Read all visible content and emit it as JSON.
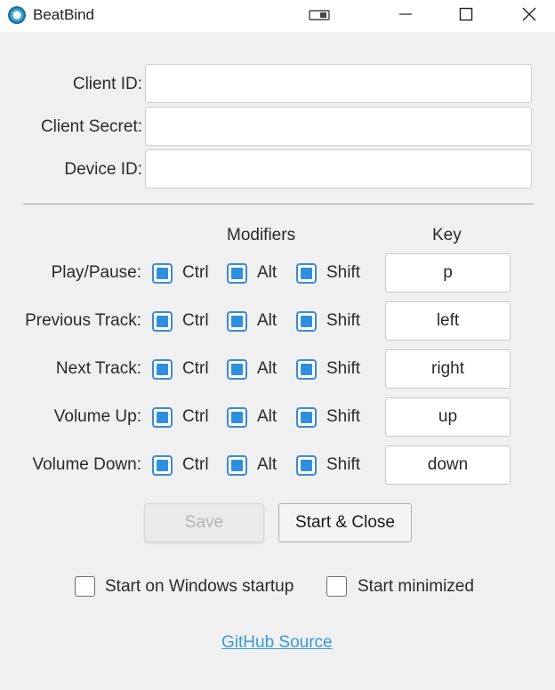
{
  "window": {
    "title": "BeatBind",
    "icons": [
      "app-icon",
      "snap-layout-icon",
      "minimize-icon",
      "maximize-icon",
      "close-icon"
    ]
  },
  "credentials": {
    "client_id_label": "Client ID:",
    "client_id_value": "",
    "client_secret_label": "Client Secret:",
    "client_secret_value": "",
    "device_id_label": "Device ID:",
    "device_id_value": ""
  },
  "hotkeys": {
    "modifiers_header": "Modifiers",
    "key_header": "Key",
    "ctrl_label": "Ctrl",
    "alt_label": "Alt",
    "shift_label": "Shift",
    "rows": [
      {
        "label": "Play/Pause:",
        "ctrl": true,
        "alt": true,
        "shift": true,
        "key": "p"
      },
      {
        "label": "Previous Track:",
        "ctrl": true,
        "alt": true,
        "shift": true,
        "key": "left"
      },
      {
        "label": "Next Track:",
        "ctrl": true,
        "alt": true,
        "shift": true,
        "key": "right"
      },
      {
        "label": "Volume Up:",
        "ctrl": true,
        "alt": true,
        "shift": true,
        "key": "up"
      },
      {
        "label": "Volume Down:",
        "ctrl": true,
        "alt": true,
        "shift": true,
        "key": "down"
      }
    ]
  },
  "actions": {
    "save_label": "Save",
    "save_enabled": false,
    "start_close_label": "Start & Close"
  },
  "options": {
    "startup_label": "Start on Windows startup",
    "startup_checked": false,
    "minimized_label": "Start minimized",
    "minimized_checked": false
  },
  "footer": {
    "link_label": "GitHub Source"
  },
  "colors": {
    "accent": "#2f8ee0",
    "link": "#3a9ad9",
    "background": "#f0f0f0"
  }
}
